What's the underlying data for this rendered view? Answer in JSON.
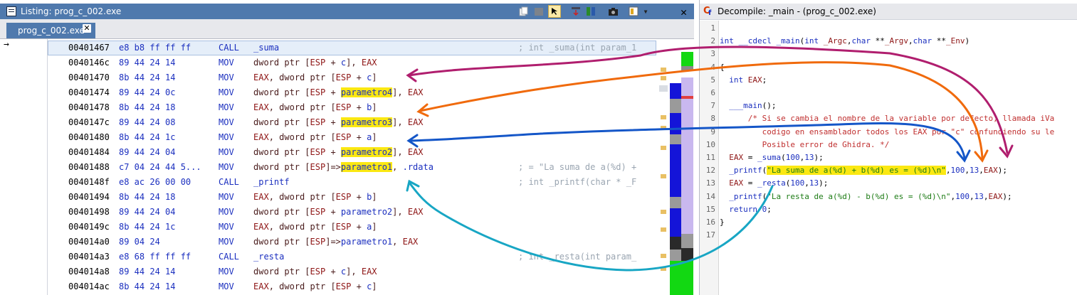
{
  "listing": {
    "title": "Listing:  prog_c_002.exe",
    "tab_label": "prog_c_002.exe",
    "toolbar_icons": [
      "copy-icon",
      "paste-icon",
      "cursor-select-icon",
      "flow-arrow-icon",
      "diff-icon",
      "camera-icon",
      "layout-icon",
      "dropdown-icon"
    ],
    "rows": [
      {
        "addr": "00401467",
        "bytes": "e8 b8 ff ff ff",
        "mnemonic": "CALL",
        "operand": "_suma",
        "comment": "; int _suma(int param_1"
      },
      {
        "addr": "0040146c",
        "bytes": "89 44 24 14",
        "mnemonic": "MOV",
        "operand": "dword ptr [ESP + c], EAX",
        "comment": ""
      },
      {
        "addr": "00401470",
        "bytes": "8b 44 24 14",
        "mnemonic": "MOV",
        "operand": "EAX, dword ptr [ESP + c]",
        "comment": ""
      },
      {
        "addr": "00401474",
        "bytes": "89 44 24 0c",
        "mnemonic": "MOV",
        "operand": "dword ptr [ESP + parametro4], EAX",
        "comment": ""
      },
      {
        "addr": "00401478",
        "bytes": "8b 44 24 18",
        "mnemonic": "MOV",
        "operand": "EAX, dword ptr [ESP + b]",
        "comment": ""
      },
      {
        "addr": "0040147c",
        "bytes": "89 44 24 08",
        "mnemonic": "MOV",
        "operand": "dword ptr [ESP + parametro3], EAX",
        "comment": ""
      },
      {
        "addr": "00401480",
        "bytes": "8b 44 24 1c",
        "mnemonic": "MOV",
        "operand": "EAX, dword ptr [ESP + a]",
        "comment": ""
      },
      {
        "addr": "00401484",
        "bytes": "89 44 24 04",
        "mnemonic": "MOV",
        "operand": "dword ptr [ESP + parametro2], EAX",
        "comment": ""
      },
      {
        "addr": "00401488",
        "bytes": "c7 04 24 44 5...",
        "mnemonic": "MOV",
        "operand": "dword ptr [ESP]=>parametro1, .rdata",
        "comment": "; = \"La suma de a(%d) +"
      },
      {
        "addr": "0040148f",
        "bytes": "e8 ac 26 00 00",
        "mnemonic": "CALL",
        "operand": "_printf",
        "comment": "; int _printf(char * _F"
      },
      {
        "addr": "00401494",
        "bytes": "8b 44 24 18",
        "mnemonic": "MOV",
        "operand": "EAX, dword ptr [ESP + b]",
        "comment": ""
      },
      {
        "addr": "00401498",
        "bytes": "89 44 24 04",
        "mnemonic": "MOV",
        "operand": "dword ptr [ESP + parametro2], EAX",
        "comment": ""
      },
      {
        "addr": "0040149c",
        "bytes": "8b 44 24 1c",
        "mnemonic": "MOV",
        "operand": "EAX, dword ptr [ESP + a]",
        "comment": ""
      },
      {
        "addr": "004014a0",
        "bytes": "89 04 24",
        "mnemonic": "MOV",
        "operand": "dword ptr [ESP]=>parametro1, EAX",
        "comment": ""
      },
      {
        "addr": "004014a3",
        "bytes": "e8 68 ff ff ff",
        "mnemonic": "CALL",
        "operand": "_resta",
        "comment": "; int _resta(int param_"
      },
      {
        "addr": "004014a8",
        "bytes": "89 44 24 14",
        "mnemonic": "MOV",
        "operand": "dword ptr [ESP + c], EAX",
        "comment": ""
      },
      {
        "addr": "004014ac",
        "bytes": "8b 44 24 14",
        "mnemonic": "MOV",
        "operand": "EAX, dword ptr [ESP + c]",
        "comment": ""
      }
    ]
  },
  "decompile": {
    "title": "Decompile: _main -  (prog_c_002.exe)",
    "line_numbers": [
      "1",
      "2",
      "3",
      "4",
      "5",
      "6",
      "7",
      "8",
      "9",
      "10",
      "11",
      "12",
      "13",
      "14",
      "15",
      "16",
      "17"
    ],
    "lines": [
      "",
      "int __cdecl _main(int _Argc,char **_Argv,char **_Env)",
      "",
      "{",
      "  int EAX;",
      "",
      "  ___main();",
      "      /* Si se cambia el nombre de la variable por defecto, llamada iVa",
      "         codigo en ensamblador todos los EAX por \"c\" confundiendo su le",
      "         Posible error de Ghidra. */",
      "  EAX = _suma(100,13);",
      "  _printf(\"La suma de a(%d) + b(%d) es = (%d)\\n\",100,13,EAX);",
      "  EAX = _resta(100,13);",
      "  _printf(\"La resta de a(%d) - b(%d) es = (%d)\\n\",100,13,EAX);",
      "  return 0;",
      "}",
      ""
    ]
  },
  "colors": {
    "title_blue": "#4f79ad",
    "highlight_yellow": "#fbe812",
    "arrow_magenta": "#b01e6e",
    "arrow_orange": "#f06a0c",
    "arrow_blue": "#1456c8",
    "arrow_teal": "#18a6c4"
  }
}
